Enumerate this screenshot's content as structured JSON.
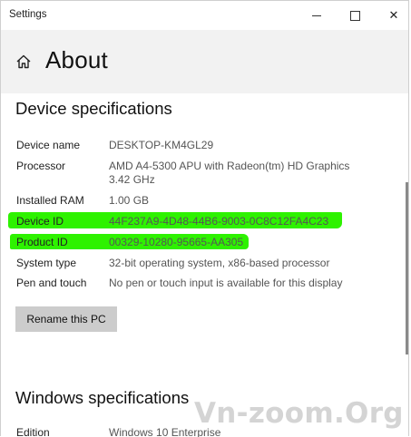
{
  "window": {
    "title": "Settings",
    "minimize_icon": "minimize-icon",
    "maximize_icon": "maximize-icon",
    "close_icon": "close-icon",
    "close_glyph": "✕"
  },
  "header": {
    "home_icon": "home-icon",
    "page_title": "About"
  },
  "device_specs": {
    "title": "Device specifications",
    "rows": [
      {
        "label": "Device name",
        "value": "DESKTOP-KM4GL29"
      },
      {
        "label": "Processor",
        "value": "AMD A4-5300 APU with Radeon(tm) HD Graphics 3.42 GHz"
      },
      {
        "label": "Installed RAM",
        "value": "1.00 GB"
      },
      {
        "label": "Device ID",
        "value": "44F237A9-4D48-44B6-9003-0C8C12FA4C23"
      },
      {
        "label": "Product ID",
        "value": "00329-10280-95665-AA305"
      },
      {
        "label": "System type",
        "value": "32-bit operating system, x86-based processor"
      },
      {
        "label": "Pen and touch",
        "value": "No pen or touch input is available for this display"
      }
    ],
    "rename_button": "Rename this PC"
  },
  "windows_specs": {
    "title": "Windows specifications",
    "rows": [
      {
        "label": "Edition",
        "value": "Windows 10 Enterprise"
      }
    ]
  },
  "highlight_color": "#2ef200",
  "watermark": "Vn-zoom.Org"
}
